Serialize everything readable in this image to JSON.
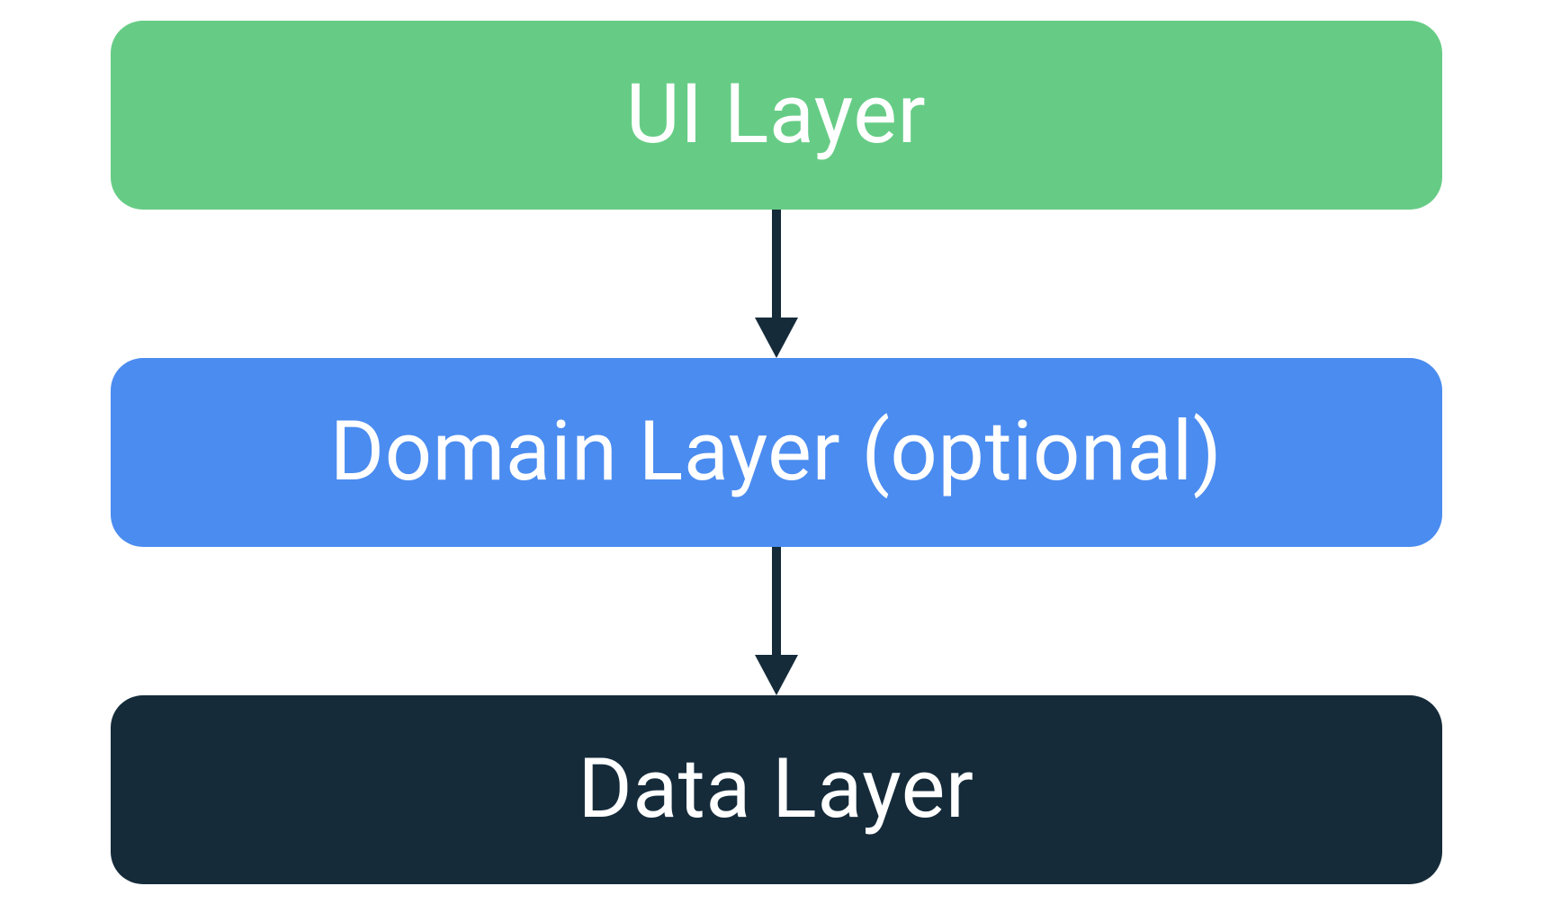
{
  "layers": {
    "ui": {
      "label": "UI Layer",
      "color": "#66cc85"
    },
    "domain": {
      "label": "Domain Layer (optional)",
      "color": "#4b8cf0"
    },
    "data": {
      "label": "Data Layer",
      "color": "#152b3a"
    }
  },
  "arrow_color": "#152b3a"
}
